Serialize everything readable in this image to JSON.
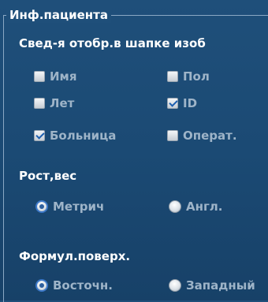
{
  "group_title": "Инф.пациента",
  "header_section": {
    "title": "Свед-я отобр.в шапке изоб",
    "options": [
      {
        "label": "Имя",
        "checked": false
      },
      {
        "label": "Пол",
        "checked": false
      },
      {
        "label": "Лет",
        "checked": false
      },
      {
        "label": "ID",
        "checked": true
      },
      {
        "label": "Больница",
        "checked": true
      },
      {
        "label": "Операт.",
        "checked": false
      }
    ]
  },
  "height_weight": {
    "title": "Рост,вес",
    "options": [
      {
        "label": "Метрич",
        "selected": true
      },
      {
        "label": "Англ.",
        "selected": false
      }
    ]
  },
  "bsa_formula": {
    "title": "Формул.поверх.",
    "options": [
      {
        "label": "Восточн.",
        "selected": true
      },
      {
        "label": "Западный",
        "selected": false
      }
    ]
  },
  "colors": {
    "background": "#1f4f7a",
    "text": "#ffffff",
    "disabled_text": "#9eb4c8",
    "accent": "#3c78c8"
  }
}
